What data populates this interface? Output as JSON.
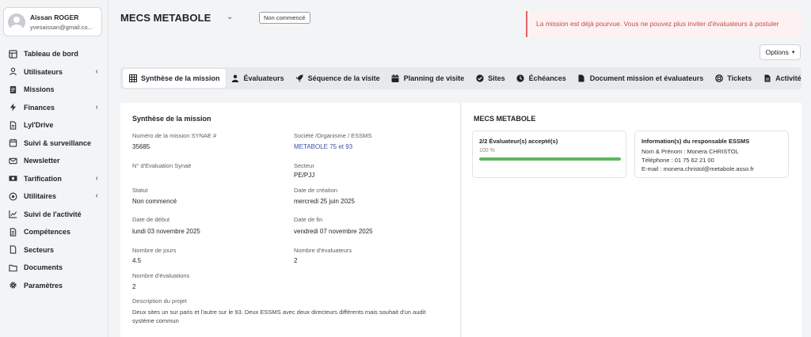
{
  "user": {
    "name": "Aïssan ROGER",
    "email": "yvesaissan@gmail.co..."
  },
  "nav": [
    {
      "label": "Tableau de bord",
      "icon": "dashboard-icon",
      "chevron": false
    },
    {
      "label": "Utilisateurs",
      "icon": "user-icon",
      "chevron": true
    },
    {
      "label": "Missions",
      "icon": "document-icon",
      "chevron": false
    },
    {
      "label": "Finances",
      "icon": "bolt-icon",
      "chevron": true
    },
    {
      "label": "Lyl'Drive",
      "icon": "file-icon",
      "chevron": false
    },
    {
      "label": "Suivi & surveillance",
      "icon": "calendar-icon",
      "chevron": false
    },
    {
      "label": "Newsletter",
      "icon": "envelope-icon",
      "chevron": false
    },
    {
      "label": "Tarification",
      "icon": "money-icon",
      "chevron": true
    },
    {
      "label": "Utilitaires",
      "icon": "target-icon",
      "chevron": true
    },
    {
      "label": "Suivi de l'activité",
      "icon": "chart-line-icon",
      "chevron": false
    },
    {
      "label": "Compétences",
      "icon": "file-lines-icon",
      "chevron": false
    },
    {
      "label": "Secteurs",
      "icon": "file-outline-icon",
      "chevron": false
    },
    {
      "label": "Documents",
      "icon": "folder-icon",
      "chevron": false
    },
    {
      "label": "Paramètres",
      "icon": "gear-icon",
      "chevron": false
    }
  ],
  "header": {
    "title": "MECS METABOLE",
    "status": "Non commencé",
    "alert": "La mission est déjà pourvue. Vous ne pouvez plus inviter d'évaluateurs à postuler",
    "options": "Options"
  },
  "tabs": [
    {
      "label": "Synthèse de la mission",
      "icon": "table-icon"
    },
    {
      "label": "Évaluateurs",
      "icon": "user-icon"
    },
    {
      "label": "Séquence de la visite",
      "icon": "rocket-icon"
    },
    {
      "label": "Planning de visite",
      "icon": "calendar-icon"
    },
    {
      "label": "Sites",
      "icon": "check-circle-icon"
    },
    {
      "label": "Échéances",
      "icon": "clock-icon"
    },
    {
      "label": "Document mission et évaluateurs",
      "icon": "file-icon"
    },
    {
      "label": "Tickets",
      "icon": "support-icon"
    },
    {
      "label": "Activité",
      "icon": "file-lines-icon"
    }
  ],
  "summary": {
    "heading": "Synthèse de la mission",
    "fields": [
      {
        "label": "Numéro de la mission SYNAE #",
        "value": "35685"
      },
      {
        "label": "Société /Organisme / ESSMS",
        "value": "METABOLE 75 et 93"
      },
      {
        "label": "N° d'Evaluation Synaé",
        "value": ""
      },
      {
        "label": "Secteur",
        "value": "PE/PJJ"
      },
      {
        "label": "Statut",
        "value": "Non commencé"
      },
      {
        "label": "Date de création",
        "value": "mercredi 25 juin 2025"
      },
      {
        "label": "Date de début",
        "value": "lundi 03 novembre 2025"
      },
      {
        "label": "Date de fin",
        "value": "vendredi 07 novembre 2025"
      },
      {
        "label": "Nombre de jours",
        "value": "4.5"
      },
      {
        "label": "Nombre d'évaluateurs",
        "value": "2"
      },
      {
        "label": "Nombre d'évaluations",
        "value": "2"
      }
    ],
    "description_label": "Description du projet",
    "description": "Deux sites un sur paris et l'autre sur le 93. Deux ESSMS avec deux directeurs différents mais souhait d'un audit système commun"
  },
  "right": {
    "heading": "MECS METABOLE",
    "evaluators": {
      "title": "2/2 Évaluateur(s) accepté(s)",
      "percent_label": "100 %",
      "progress": 1.0,
      "color": "#5cb85c"
    },
    "responsible": {
      "title": "Information(s) du responsable ESSMS",
      "name": "Nom & Prénom : Monera CHRISTOL",
      "phone": "Téléphone : 01 75 62 21 00",
      "email": "E-mail : monera.christol@metabole.asso.fr"
    }
  }
}
